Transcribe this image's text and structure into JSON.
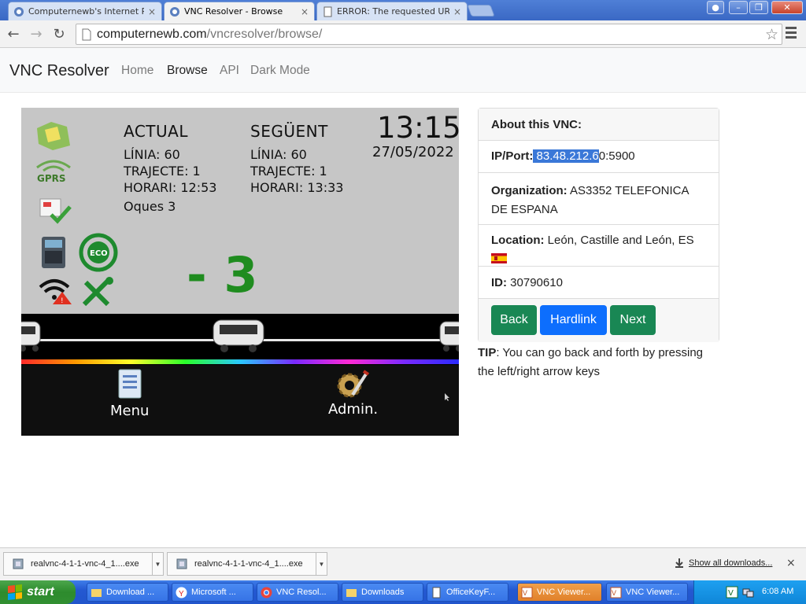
{
  "browser": {
    "tabs": [
      {
        "label": "Computernewb's Internet Pu",
        "active": false
      },
      {
        "label": "VNC Resolver - Browse",
        "active": true
      },
      {
        "label": "ERROR: The requested URL",
        "active": false
      }
    ],
    "close_glyph": "×",
    "url_host": "computernewb.com",
    "url_path": "/vncresolver/browse/"
  },
  "site": {
    "brand": "VNC Resolver",
    "nav": [
      {
        "label": "Home",
        "active": false
      },
      {
        "label": "Browse",
        "active": true
      },
      {
        "label": "API",
        "active": false
      },
      {
        "label": "Dark Mode",
        "active": false
      }
    ]
  },
  "vnc_screen": {
    "col1_heading": "ACTUAL",
    "col1_line": "LÍNIA: 60",
    "col1_route": "TRAJECTE: 1",
    "col1_time": "HORARI: 12:53",
    "col1_stop": "Oques 3",
    "col2_heading": "SEGÜENT",
    "col2_line": "LÍNIA: 60",
    "col2_route": "TRAJECTE: 1",
    "col2_time": "HORARI: 13:33",
    "clock": "13:15",
    "date": "27/05/2022",
    "counter": "- 3",
    "eco_label": "ECO",
    "gprs_label": "GPRS",
    "menu_label": "Menu",
    "admin_label": "Admin."
  },
  "info": {
    "header": "About this VNC:",
    "ip_label": "IP/Port:",
    "ip_selected": " 83.48.212.6",
    "ip_rest": "0:5900",
    "org_label": "Organization:",
    "org_value": " AS3352 TELEFONICA DE ESPANA",
    "loc_label": "Location:",
    "loc_value": " León, Castille and León, ES",
    "id_label": "ID:",
    "id_value": " 30790610",
    "back": "Back",
    "hardlink": "Hardlink",
    "next": "Next"
  },
  "tip": {
    "label": "TIP",
    "text": ": You can go back and forth by pressing the left/right arrow keys"
  },
  "downloads": {
    "items": [
      "realvnc-4-1-1-vnc-4_1....exe",
      "realvnc-4-1-1-vnc-4_1....exe"
    ],
    "show_all": "Show all downloads...",
    "close": "×"
  },
  "taskbar": {
    "start": "start",
    "tasks": [
      {
        "label": "Download ...",
        "active": false
      },
      {
        "label": "Microsoft ...",
        "active": false
      },
      {
        "label": "VNC Resol...",
        "active": false
      },
      {
        "label": "Downloads",
        "active": false
      },
      {
        "label": "OfficeKeyF...",
        "active": false
      },
      {
        "label": "VNC Viewer...",
        "active": true
      },
      {
        "label": "VNC Viewer...",
        "active": false
      }
    ],
    "clock": "6:08 AM"
  },
  "colors": {
    "accent_blue": "#0d6efd",
    "accent_green": "#198754",
    "selection": "#3a78d8",
    "counter_green": "#1f8c1f"
  }
}
